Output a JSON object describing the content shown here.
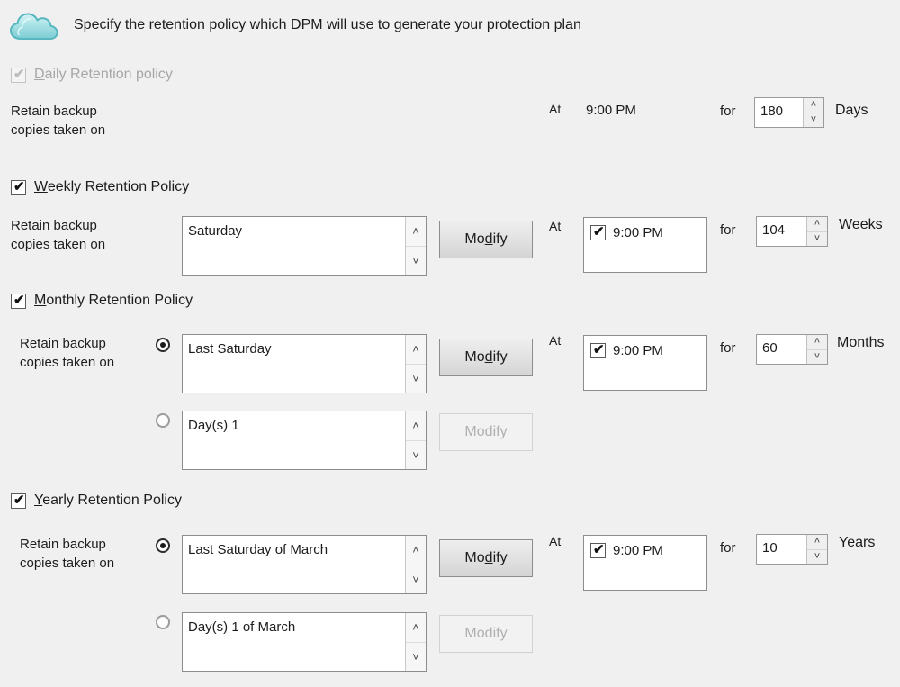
{
  "header": {
    "icon": "cloud-icon",
    "text": "Specify the retention policy which DPM will use to generate your protection plan"
  },
  "common": {
    "retain_label": "Retain backup\ncopies taken on",
    "at_label": "At",
    "for_label": "for",
    "modify_label_pre": "Mo",
    "modify_label_accel": "d",
    "modify_label_post": "ify",
    "arrow_up": "˄",
    "arrow_down": "˅",
    "check_glyph": "✔"
  },
  "colors": {
    "background": "#f0f0f0",
    "cloud_light": "#cdeff0",
    "cloud_mid": "#8fd8dd",
    "cloud_outline": "#5bb8c0",
    "text": "#1c1c1c",
    "disabled_text": "#a6a6a6",
    "border": "#8d8d8d"
  },
  "sections": {
    "daily": {
      "accel": "D",
      "label_rest": "aily Retention policy",
      "enabled": false,
      "checked": true,
      "time": "9:00 PM",
      "count": "180",
      "unit": "Days"
    },
    "weekly": {
      "accel": "W",
      "label_rest": "eekly Retention Policy",
      "enabled": true,
      "checked": true,
      "list_value": "Saturday",
      "modify_enabled": true,
      "time_checked": true,
      "time": "9:00 PM",
      "count": "104",
      "unit": "Weeks"
    },
    "monthly": {
      "accel": "M",
      "label_rest": "onthly Retention Policy",
      "enabled": true,
      "checked": true,
      "option_a": {
        "selected": true,
        "list_value": "Last Saturday",
        "modify_enabled": true
      },
      "option_b": {
        "selected": false,
        "list_value": "Day(s) 1",
        "modify_enabled": false
      },
      "time_checked": true,
      "time": "9:00 PM",
      "count": "60",
      "unit": "Months"
    },
    "yearly": {
      "accel": "Y",
      "label_rest": "early Retention Policy",
      "enabled": true,
      "checked": true,
      "option_a": {
        "selected": true,
        "list_value": "Last Saturday of March",
        "modify_enabled": true
      },
      "option_b": {
        "selected": false,
        "list_value": "Day(s) 1 of March",
        "modify_enabled": false
      },
      "time_checked": true,
      "time": "9:00 PM",
      "count": "10",
      "unit": "Years"
    }
  }
}
